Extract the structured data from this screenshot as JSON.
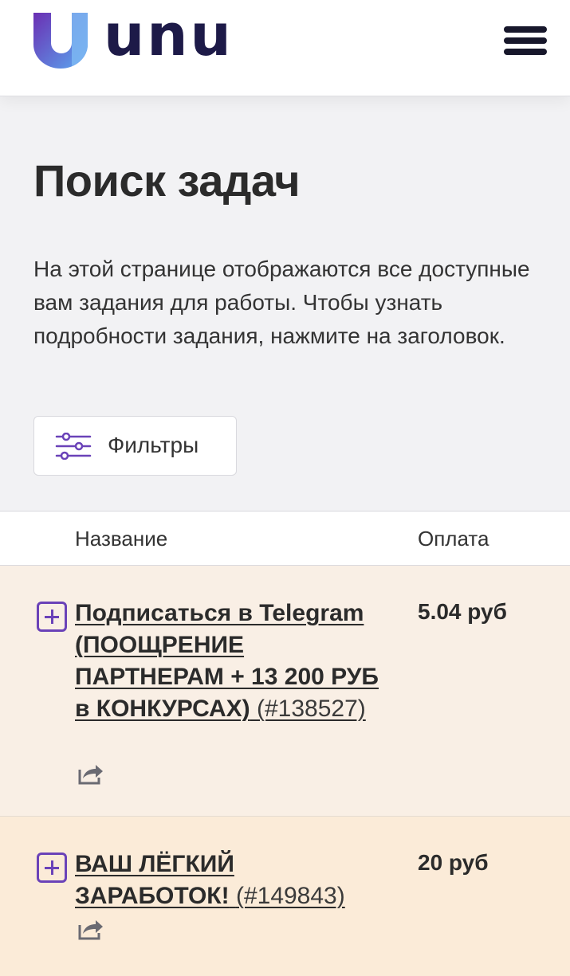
{
  "header": {
    "logo_text": "unu",
    "brand_colors": {
      "logo_top": "#6b2fb3",
      "logo_bottom": "#5aa8f0",
      "text": "#1d1a48"
    },
    "menu_icon": "hamburger-icon"
  },
  "page": {
    "title": "Поиск задач",
    "description": "На этой странице отображаются все доступные вам задания для работы. Чтобы узнать подробности задания, нажмите на заголовок."
  },
  "filters": {
    "label": "Фильтры",
    "icon": "sliders-icon"
  },
  "table": {
    "columns": {
      "name": "Название",
      "payment": "Оплата"
    },
    "rows": [
      {
        "title": "Подписаться в Telegram (ПООЩРЕНИЕ ПАРТНЕРАМ + 13 200 РУБ в КОНКУРСАХ)",
        "id": "(#138527)",
        "price": "5.04 руб",
        "background": "#f9efe5"
      },
      {
        "title": "ВАШ ЛЁГКИЙ ЗАРАБОТОК!",
        "id": "(#149843)",
        "price": "20 руб",
        "background": "#fbebd8"
      }
    ]
  },
  "accent_color": "#6a42b8"
}
